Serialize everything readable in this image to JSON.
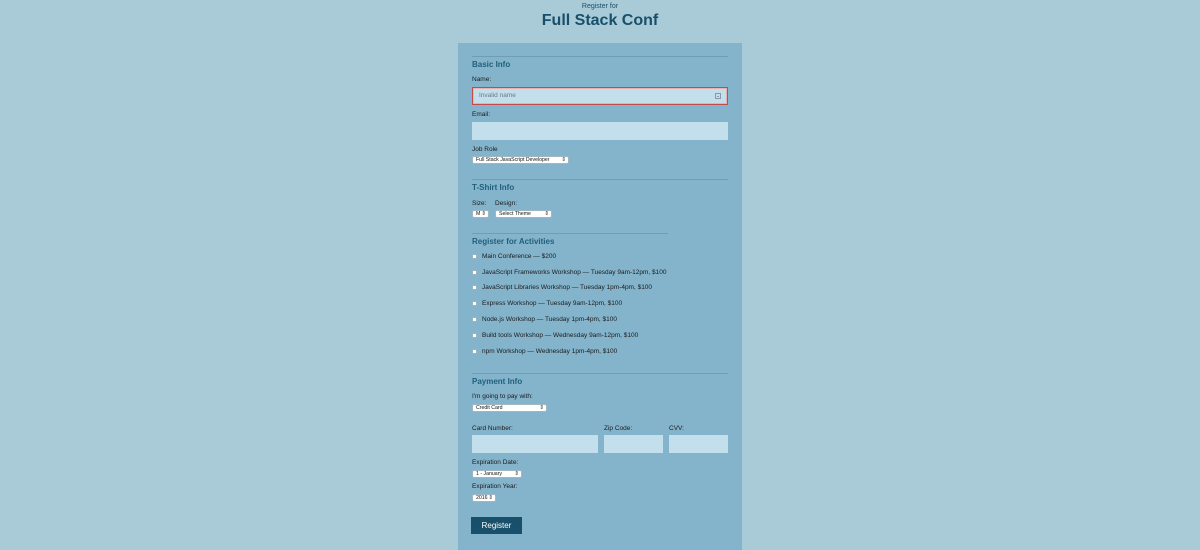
{
  "header": {
    "kicker": "Register for",
    "title": "Full Stack Conf"
  },
  "basic": {
    "heading": "Basic Info",
    "name_label": "Name:",
    "name_placeholder": "Invalid name",
    "email_label": "Email:",
    "job_label": "Job Role",
    "job_value": "Full Stack JavaScript Developer"
  },
  "tshirt": {
    "heading": "T-Shirt Info",
    "size_label": "Size:",
    "size_value": "M",
    "design_label": "Design:",
    "design_value": "Select Theme"
  },
  "activities": {
    "heading": "Register for Activities",
    "items": [
      "Main Conference — $200",
      "JavaScript Frameworks Workshop — Tuesday 9am-12pm, $100",
      "JavaScript Libraries Workshop — Tuesday 1pm-4pm, $100",
      "Express Workshop — Tuesday 9am-12pm, $100",
      "Node.js Workshop — Tuesday 1pm-4pm, $100",
      "Build tools Workshop — Wednesday 9am-12pm, $100",
      "npm Workshop — Wednesday 1pm-4pm, $100"
    ]
  },
  "payment": {
    "heading": "Payment Info",
    "pay_label": "I'm going to pay with:",
    "pay_value": "Credit Card",
    "card_label": "Card Number:",
    "zip_label": "Zip Code:",
    "cvv_label": "CVV:",
    "exp_date_label": "Expiration Date:",
    "exp_date_value": "1 - January",
    "exp_year_label": "Expiration Year:",
    "exp_year_value": "2016"
  },
  "submit_label": "Register",
  "icons": {
    "select": "select-arrow-icon",
    "autofill": "contact-card-icon"
  }
}
